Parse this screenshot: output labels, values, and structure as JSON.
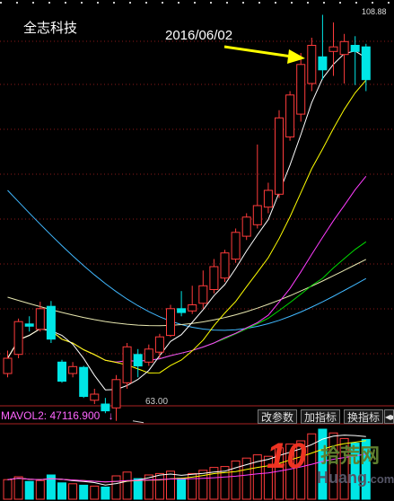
{
  "stock_name": "全志科技",
  "annotation": {
    "date": "2016/06/02"
  },
  "price_high_label": "108.88",
  "price_low_label": "63.00",
  "volume_indicator": {
    "label": "MAVOL2:",
    "value": "47116.900",
    "arrow": "↓"
  },
  "toolbar": {
    "btn1": "改参数",
    "btn2": "加指标",
    "btn3": "换指标",
    "btn4": "◀▶"
  },
  "watermark": {
    "big": "10",
    "cn": "拾荒网",
    "en": "Huang",
    "dom": ".com"
  },
  "colors": {
    "up": "#ff3b3b",
    "down": "#00e6e6",
    "ma_white": "#ffffff",
    "ma_yellow": "#ffff00",
    "ma_magenta": "#ff3cff",
    "ma_green": "#00dd00",
    "ma_cyan": "#40b8ff",
    "ma_pale": "#e8e8b0",
    "grid": "#8b1a1a",
    "arrow": "#ffff00"
  },
  "chart_data": {
    "type": "candlestick",
    "ylim": [
      60,
      112
    ],
    "candles": [
      {
        "o": 64.0,
        "c": 66.0,
        "h": 67.0,
        "l": 63.5
      },
      {
        "o": 66.5,
        "c": 70.8,
        "h": 71.2,
        "l": 66.0
      },
      {
        "o": 70.5,
        "c": 70.2,
        "h": 71.5,
        "l": 69.5
      },
      {
        "o": 69.8,
        "c": 72.5,
        "h": 73.4,
        "l": 69.5
      },
      {
        "o": 72.8,
        "c": 68.5,
        "h": 73.5,
        "l": 68.0
      },
      {
        "o": 65.5,
        "c": 63.0,
        "h": 65.8,
        "l": 62.8
      },
      {
        "o": 64.0,
        "c": 64.9,
        "h": 65.5,
        "l": 63.5
      },
      {
        "o": 64.8,
        "c": 61.0,
        "h": 65.0,
        "l": 60.8
      },
      {
        "o": 60.5,
        "c": 61.3,
        "h": 62.0,
        "l": 60.0
      },
      {
        "o": 60.0,
        "c": 59.1,
        "h": 60.8,
        "l": 58.8
      },
      {
        "o": 59.5,
        "c": 63.2,
        "h": 63.8,
        "l": 57.8
      },
      {
        "o": 62.8,
        "c": 67.5,
        "h": 68.0,
        "l": 62.0
      },
      {
        "o": 66.5,
        "c": 65.0,
        "h": 67.2,
        "l": 63.5
      },
      {
        "o": 65.5,
        "c": 67.2,
        "h": 67.8,
        "l": 65.0
      },
      {
        "o": 66.8,
        "c": 68.8,
        "h": 69.2,
        "l": 66.0
      },
      {
        "o": 69.0,
        "c": 72.5,
        "h": 73.0,
        "l": 68.8
      },
      {
        "o": 72.5,
        "c": 72.0,
        "h": 74.8,
        "l": 71.5
      },
      {
        "o": 72.2,
        "c": 73.0,
        "h": 75.5,
        "l": 71.8
      },
      {
        "o": 73.2,
        "c": 75.5,
        "h": 77.5,
        "l": 72.5
      },
      {
        "o": 75.0,
        "c": 78.0,
        "h": 79.0,
        "l": 74.5
      },
      {
        "o": 76.5,
        "c": 79.8,
        "h": 80.2,
        "l": 76.0
      },
      {
        "o": 79.0,
        "c": 82.5,
        "h": 83.0,
        "l": 78.5
      },
      {
        "o": 82.0,
        "c": 84.5,
        "h": 85.0,
        "l": 81.5
      },
      {
        "o": 83.5,
        "c": 86.0,
        "h": 94.0,
        "l": 83.0
      },
      {
        "o": 85.8,
        "c": 88.0,
        "h": 89.0,
        "l": 85.0
      },
      {
        "o": 87.5,
        "c": 97.5,
        "h": 98.5,
        "l": 87.0
      },
      {
        "o": 95.0,
        "c": 100.5,
        "h": 101.0,
        "l": 94.5
      },
      {
        "o": 98.0,
        "c": 104.5,
        "h": 106.0,
        "l": 97.0
      },
      {
        "o": 102.0,
        "c": 107.0,
        "h": 108.0,
        "l": 101.0
      },
      {
        "o": 105.5,
        "c": 103.8,
        "h": 111.0,
        "l": 102.5
      },
      {
        "o": 106.2,
        "c": 106.8,
        "h": 110.0,
        "l": 103.0
      },
      {
        "o": 105.8,
        "c": 107.5,
        "h": 108.5,
        "l": 102.0
      },
      {
        "o": 107.0,
        "c": 106.2,
        "h": 108.2,
        "l": 101.8
      },
      {
        "o": 106.8,
        "c": 102.5,
        "h": 107.2,
        "l": 101.0
      }
    ],
    "volumes": [
      42,
      48,
      38,
      40,
      52,
      35,
      33,
      30,
      28,
      26,
      50,
      58,
      44,
      52,
      55,
      60,
      45,
      55,
      62,
      68,
      70,
      82,
      88,
      95,
      92,
      110,
      118,
      125,
      140,
      150,
      142,
      130,
      120,
      128
    ]
  }
}
